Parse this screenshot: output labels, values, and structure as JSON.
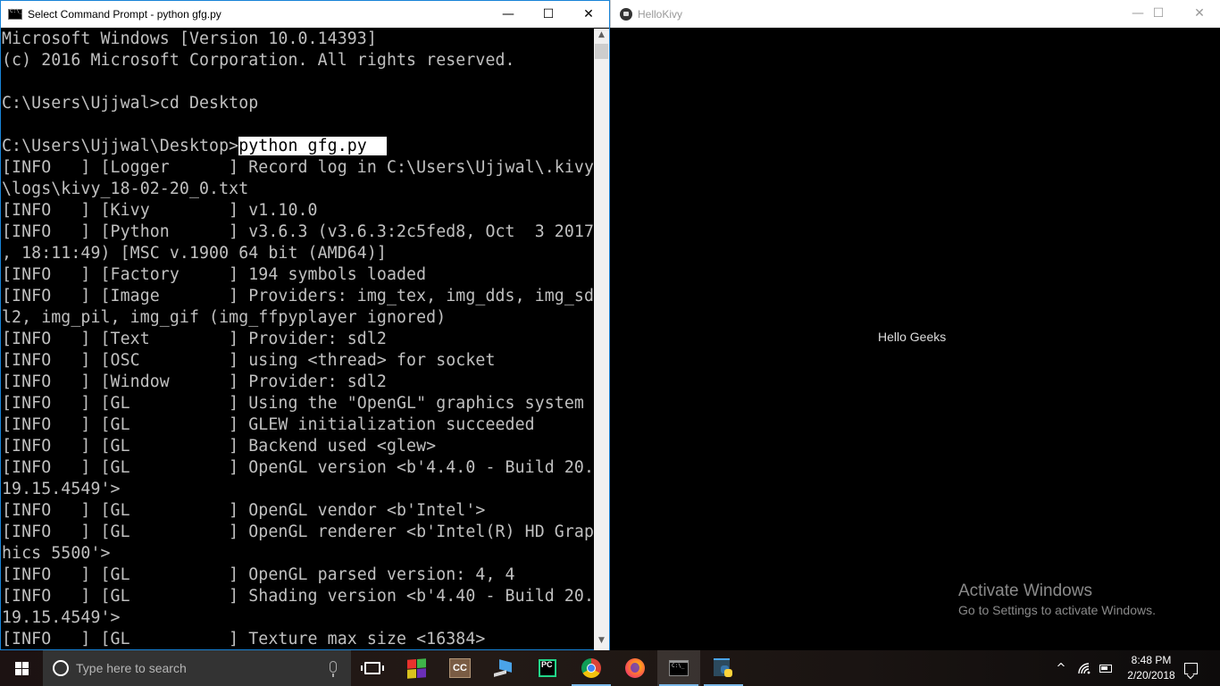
{
  "cmd_window": {
    "title": "Select Command Prompt - python  gfg.py",
    "controls": {
      "minimize": "—",
      "maximize": "☐",
      "close": "✕"
    },
    "lines": [
      "Microsoft Windows [Version 10.0.14393]",
      "(c) 2016 Microsoft Corporation. All rights reserved.",
      "",
      "C:\\Users\\Ujjwal>cd Desktop",
      "",
      "C:\\Users\\Ujjwal\\Desktop>",
      "[INFO   ] [Logger      ] Record log in C:\\Users\\Ujjwal\\.kivy",
      "\\logs\\kivy_18-02-20_0.txt",
      "[INFO   ] [Kivy        ] v1.10.0",
      "[INFO   ] [Python      ] v3.6.3 (v3.6.3:2c5fed8, Oct  3 2017",
      ", 18:11:49) [MSC v.1900 64 bit (AMD64)]",
      "[INFO   ] [Factory     ] 194 symbols loaded",
      "[INFO   ] [Image       ] Providers: img_tex, img_dds, img_sd",
      "l2, img_pil, img_gif (img_ffpyplayer ignored)",
      "[INFO   ] [Text        ] Provider: sdl2",
      "[INFO   ] [OSC         ] using <thread> for socket",
      "[INFO   ] [Window      ] Provider: sdl2",
      "[INFO   ] [GL          ] Using the \"OpenGL\" graphics system",
      "[INFO   ] [GL          ] GLEW initialization succeeded",
      "[INFO   ] [GL          ] Backend used <glew>",
      "[INFO   ] [GL          ] OpenGL version <b'4.4.0 - Build 20.",
      "19.15.4549'>",
      "[INFO   ] [GL          ] OpenGL vendor <b'Intel'>",
      "[INFO   ] [GL          ] OpenGL renderer <b'Intel(R) HD Grap",
      "hics 5500'>",
      "[INFO   ] [GL          ] OpenGL parsed version: 4, 4",
      "[INFO   ] [GL          ] Shading version <b'4.40 - Build 20.",
      "19.15.4549'>",
      "[INFO   ] [GL          ] Texture max size <16384>"
    ],
    "selected_command": "python gfg.py  ",
    "scroll_up_icon": "▲",
    "scroll_down_icon": "▼"
  },
  "kivy_window": {
    "title": "HelloKivy",
    "controls": {
      "minimize": "—",
      "maximize": "☐",
      "close": "✕"
    },
    "label_text": "Hello Geeks",
    "watermark": {
      "title": "Activate Windows",
      "subtitle": "Go to Settings to activate Windows."
    }
  },
  "taskbar": {
    "search_placeholder": "Type here to search",
    "pinned": [
      {
        "name": "store",
        "label": "Microsoft Store"
      },
      {
        "name": "cc",
        "label": "CC"
      },
      {
        "name": "this-pc",
        "label": "This PC"
      },
      {
        "name": "pycharm",
        "label": "PC"
      },
      {
        "name": "chrome",
        "label": "Google Chrome"
      },
      {
        "name": "firefox",
        "label": "Firefox"
      },
      {
        "name": "command-prompt",
        "label": "Command Prompt"
      },
      {
        "name": "python",
        "label": "Python"
      }
    ],
    "tray": {
      "chevron": "^",
      "time": "8:48 PM",
      "date": "2/20/2018"
    }
  }
}
